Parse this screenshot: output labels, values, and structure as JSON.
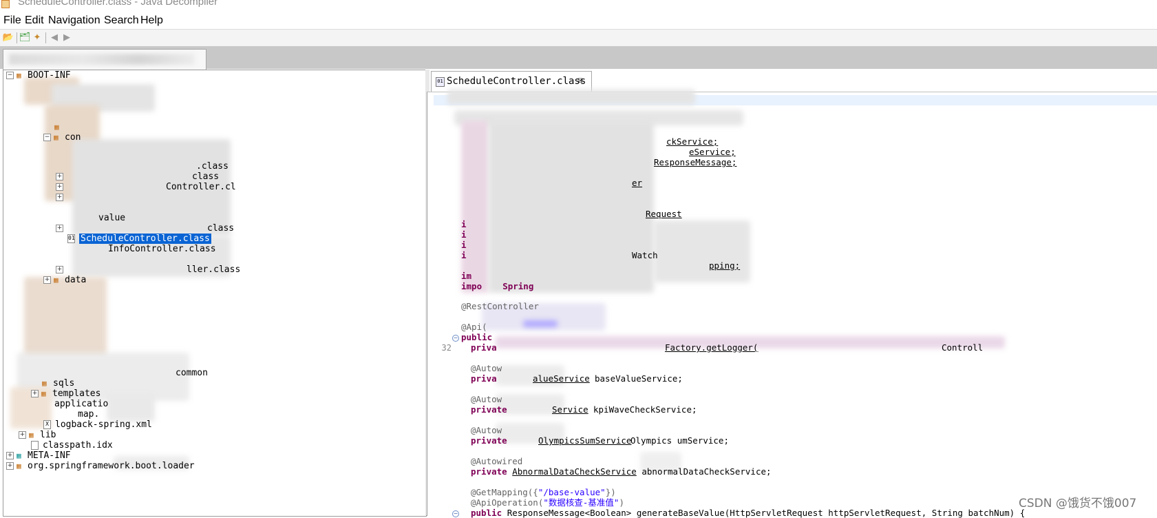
{
  "window": {
    "title": "ScheduleController.class - Java Decompiler"
  },
  "menu": [
    "File",
    "Edit",
    "Navigation",
    "Search",
    "Help"
  ],
  "toolbar": {
    "icons": [
      "open-file-icon",
      "open-type-icon",
      "open-type-hierarchy-icon",
      "back-icon",
      "forward-icon"
    ]
  },
  "tree": {
    "rows": [
      {
        "label": "BOOT-INF",
        "kind": "package"
      },
      {
        "label": "data",
        "kind": "package"
      },
      {
        "label": "ScheduleController.class",
        "kind": "class",
        "selected": true
      },
      {
        "label": "sqls",
        "kind": "package"
      },
      {
        "label": "templates",
        "kind": "package"
      },
      {
        "label": "logback-spring.xml",
        "kind": "file"
      },
      {
        "label": "lib",
        "kind": "package"
      },
      {
        "label": "classpath.idx",
        "kind": "file"
      },
      {
        "label": "META-INF",
        "kind": "package"
      },
      {
        "label": "org.springframework.boot.loader",
        "kind": "package"
      }
    ],
    "fragments": {
      "con": "con",
      "class1": ".class",
      "class2": "class",
      "controller_cl": "Controller.cl",
      "value": "value",
      "class3": "class",
      "info_controller": "InfoController.class",
      "ller_class": "ller.class",
      "common": "common",
      "application": "applicatio",
      "map": "map."
    }
  },
  "editor": {
    "tab_label": "ScheduleController.class",
    "tab_close": "☒",
    "line_number": "32",
    "code": {
      "ck_service": "ckService;",
      "e_service": "eService;",
      "response_message": "ResponseMessage;",
      "er": "er",
      "request": "Request",
      "i_r": "i",
      "i_r2": "i",
      "i_r3": "i",
      "i_r4": "i",
      "watch": "Watch",
      "im_pping": "pping;",
      "im": "im",
      "impo_spring": "impo    Spring",
      "rest_controller": "@RestController",
      "api": "@Api(",
      "public": "public",
      "private_logger_a": "priva",
      "logger_factory": "Factory.getLogger(",
      "controller_frag": "Controll",
      "autowired1": "@Autow",
      "private1": "priva",
      "base_value_service": "alueService",
      "base_value_field": "baseValueService;",
      "autowired2": "@Autow",
      "private2": "private",
      "wave_check_service": "Service",
      "kpi_wave_check": "kpiWaveCheckService;",
      "autowired3": "@Autow",
      "private3": "private",
      "olympics_sum_service": "OlympicsSumService",
      "olympics_field": "Olympics umService;",
      "autowired4": "@Autowired",
      "private4_kw": "private",
      "abnormal_type": "AbnormalDataCheckService",
      "abnormal_field": "abnormalDataCheckService;",
      "get_mapping": "@GetMapping({",
      "get_mapping_path": "\"/base-value\"",
      "get_mapping_end": "})",
      "api_operation": "@ApiOperation(",
      "api_operation_value": "\"数据核查-基准值\"",
      "api_operation_end": ")",
      "method_sig_kw": "public",
      "method_sig": "ResponseMessage<Boolean> generateBaseValue(HttpServletRequest httpServletRequest, String batchNum) {"
    }
  },
  "watermark": "CSDN @饿货不饿007",
  "colors": {
    "selection": "#0a64d4",
    "keyword": "#7f0055",
    "annotation": "#646464",
    "string": "#2a00ff",
    "current_line": "#e8f2fe"
  }
}
